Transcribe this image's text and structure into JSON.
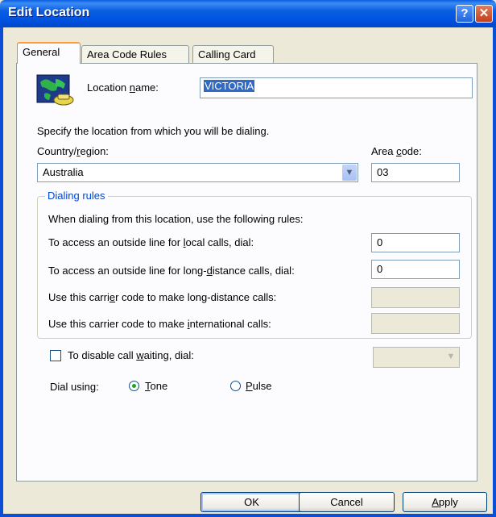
{
  "window": {
    "title": "Edit Location",
    "help_glyph": "?",
    "close_glyph": "✕"
  },
  "tabs": [
    {
      "label": "General",
      "active": true
    },
    {
      "label": "Area Code Rules",
      "active": false
    },
    {
      "label": "Calling Card",
      "active": false
    }
  ],
  "location": {
    "label_pre": "Location ",
    "label_u": "n",
    "label_post": "ame:",
    "value": "VICTORIA",
    "icon": "globe-phone-icon"
  },
  "instruction": "Specify the location from which you will be dialing.",
  "country": {
    "label_pre": "Country/",
    "label_u": "r",
    "label_post": "egion:",
    "value": "Australia"
  },
  "area_code": {
    "label_pre": "Area ",
    "label_u": "c",
    "label_post": "ode:",
    "value": "03"
  },
  "dialing_rules": {
    "legend": "Dialing rules",
    "intro": "When dialing from this location, use the following rules:",
    "local": {
      "label_pre": "To access an outside line for ",
      "label_u": "l",
      "label_post": "ocal calls, dial:",
      "value": "0"
    },
    "long_distance": {
      "label_pre": "To access an outside line for long-",
      "label_u": "d",
      "label_post": "istance calls, dial:",
      "value": "0"
    },
    "carrier_long": {
      "label_pre": "Use this carri",
      "label_u": "e",
      "label_post": "r code to make long-distance calls:",
      "value": ""
    },
    "carrier_intl": {
      "label_pre": "Use this carrier code to make ",
      "label_u": "i",
      "label_post": "nternational calls:",
      "value": ""
    }
  },
  "call_waiting": {
    "label_pre": "To disable call ",
    "label_u": "w",
    "label_post": "aiting, dial:",
    "checked": false,
    "value": ""
  },
  "dial_using": {
    "label": "Dial using:",
    "tone_u": "T",
    "tone_post": "one",
    "pulse_u": "P",
    "pulse_post": "ulse",
    "selected": "Tone"
  },
  "buttons": {
    "ok": "OK",
    "cancel": "Cancel",
    "apply_u": "A",
    "apply_post": "pply"
  }
}
